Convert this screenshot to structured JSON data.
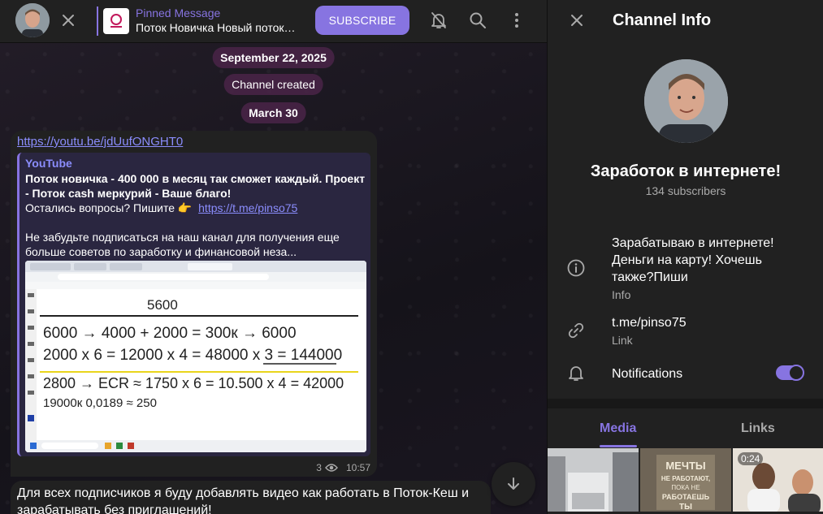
{
  "header": {
    "pinned_title": "Pinned Message",
    "pinned_text": "Поток Новичка Новый поток…",
    "subscribe_label": "SUBSCRIBE"
  },
  "chat": {
    "date1": "September 22, 2025",
    "service": "Channel created",
    "date2": "March 30",
    "message1": {
      "url": "https://youtu.be/jdUufONGHT0",
      "preview_site": "YouTube",
      "preview_title": "Поток новичка  - 400 000 в месяц  так сможет каждый. Проект - Поток cash меркурий - Ваше благо!",
      "preview_desc_line1": "Остались вопросы? Пишите 👉",
      "preview_desc_link": "https://t.me/pinso75",
      "preview_desc_line2": "Не забудьте подписаться на наш канал для получения еще больше советов по заработку и финансовой неза...",
      "views": "3",
      "time": "10:57",
      "whiteboard": {
        "l1": "5600",
        "l2": "6000 → 4000 + 2000 = 300к → 6000",
        "l3": "2000 x 6 = 12000 x 4 = 48000 x 3 = 144000",
        "l4": "2800 → ECR ≈ 1750 x 6 = 10.500 x 4 = 42000",
        "l5": "19000к 0,0189 ≈ 250"
      }
    },
    "message2": {
      "text": "Для всех подписчиков я буду добавлять видео как работать в Поток-Кеш и зарабатывать без приглашений!"
    }
  },
  "info": {
    "title": "Channel Info",
    "channel_name": "Заработок в интернете!",
    "subscribers": "134 subscribers",
    "description": "Зарабатываю в интернете! Деньги на карту! Хочешь также?Пиши",
    "description_label": "Info",
    "link": "t.me/pinso75",
    "link_label": "Link",
    "notifications_label": "Notifications",
    "notifications_on": true,
    "tabs": [
      "Media",
      "Links"
    ],
    "media": [
      {
        "duration": ""
      },
      {
        "caption": "МЕЧТЫ НЕ РАБОТАЮТ, ПОКА НЕ РАБОТАЕШЬ ТЫ",
        "duration": ""
      },
      {
        "duration": "0:24"
      }
    ]
  },
  "colors": {
    "accent": "#8774e1",
    "bubble": "#212121",
    "link": "#8b8dfd"
  }
}
